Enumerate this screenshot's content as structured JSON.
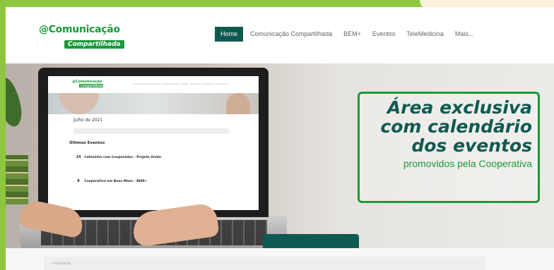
{
  "brand": {
    "logo_main": "@Comunicação",
    "logo_sub": "Compartilhada"
  },
  "nav": {
    "items": [
      {
        "label": "Home",
        "active": true
      },
      {
        "label": "Comunicação Compartilhada",
        "active": false
      },
      {
        "label": "BEM+",
        "active": false
      },
      {
        "label": "Eventos",
        "active": false
      },
      {
        "label": "TeleMedicina",
        "active": false
      },
      {
        "label": "Mais...",
        "active": false
      }
    ]
  },
  "hero": {
    "promo_lines": [
      "Área exclusiva",
      "com calendário",
      "dos eventos"
    ],
    "promo_sub": "promovidos  pela Cooperativa"
  },
  "laptop_screen": {
    "breadcrumb": "Julho de 2021",
    "section_title": "Últimos Eventos",
    "events": [
      {
        "day": "14",
        "title": "Cafezinho com Cooperados – Projeto Unido"
      },
      {
        "day": "8",
        "title": "Cooperativa em Boas Mãos – BEM+"
      }
    ]
  },
  "search": {
    "placeholder": "Pesquisar"
  },
  "colors": {
    "brand_green": "#1a9a3a",
    "dark_teal": "#0f5a50",
    "frame_green": "#8ec63f"
  }
}
